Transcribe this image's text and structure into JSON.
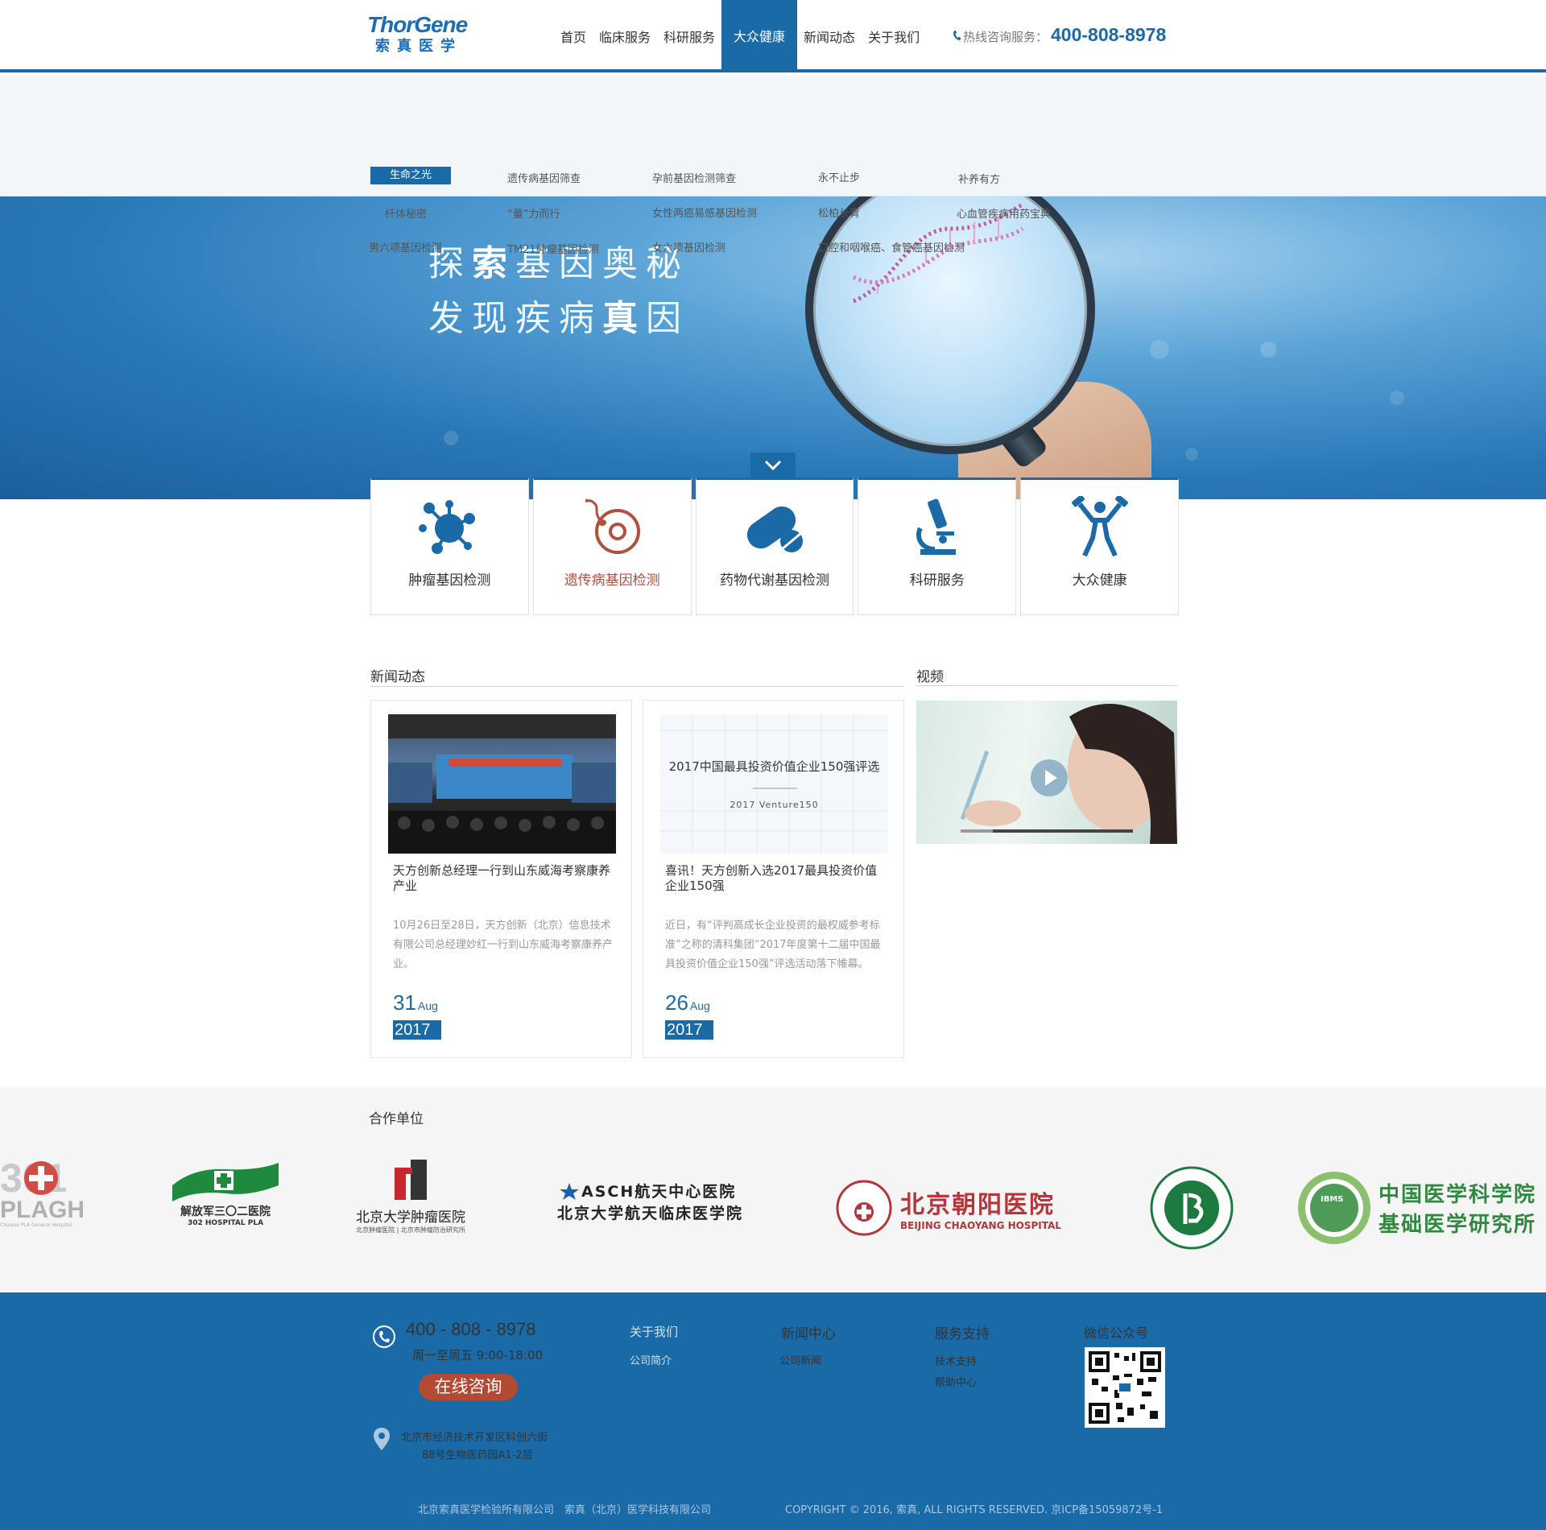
{
  "brand": {
    "name_en": "ThorGene",
    "name_cn": "索真医学"
  },
  "nav": {
    "items": [
      "首页",
      "临床服务",
      "科研服务",
      "大众健康",
      "新闻动态",
      "关于我们"
    ],
    "active_index": 3
  },
  "hotline": {
    "label": "热线咨询服务：",
    "number": "400-808-8978"
  },
  "dropdown": {
    "items": [
      "生命之光",
      "遗传病基因筛查",
      "孕前基因检测筛查",
      "永不止步",
      "补养有方",
      "纤体秘密",
      "“量”力而行",
      "女性两癌易感基因检测",
      "松柏长青",
      "心血管疾病用药宝典",
      "男六项基因检测",
      "TM21肿瘤基因检测",
      "女六项基因检测",
      "口腔和咽喉癌、食管癌基因检测"
    ]
  },
  "banner": {
    "line1_a": "探",
    "line1_b": "索",
    "line1_c": "基因奥秘",
    "line2_a": "发现疾病",
    "line2_b": "真",
    "line2_c": "因"
  },
  "services": [
    {
      "label": "肿瘤基因检测",
      "icon": "molecule-icon"
    },
    {
      "label": "遗传病基因检测",
      "icon": "sperm-egg-icon"
    },
    {
      "label": "药物代谢基因检测",
      "icon": "pill-icon"
    },
    {
      "label": "科研服务",
      "icon": "microscope-icon"
    },
    {
      "label": "大众健康",
      "icon": "fitness-person-icon"
    }
  ],
  "news": {
    "title": "新闻动态",
    "items": [
      {
        "title": "天方创新总经理一行到山东威海考察康养产业",
        "excerpt": "10月26日至28日，天方创新（北京）信息技术有限公司总经理妙红一行到山东威海考察康养产业。",
        "day": "31",
        "month": "Aug",
        "year": "2017"
      },
      {
        "title": "喜讯！天方创新入选2017最具投资价值企业150强",
        "excerpt": "近日，有“评判高成长企业投资的最权威参考标准”之称的清科集团“2017年度第十二届中国最具投资价值企业150强”评选活动落下帷幕。",
        "day": "26",
        "month": "Aug",
        "year": "2017",
        "image_caption": "2017中国最具投资价值企业150强评选",
        "image_sub": "2017 Venture150"
      }
    ]
  },
  "video": {
    "title": "视频"
  },
  "partners": {
    "title": "合作单位",
    "items": [
      {
        "name": "PLAGH",
        "sub": "Chinese PLA General Hospital",
        "mark": "301"
      },
      {
        "name": "解放军三〇二医院",
        "sub": "302 HOSPITAL PLA"
      },
      {
        "name": "北京大学肿瘤医院",
        "sub": "北京肿瘤医院 | 北京市肿瘤防治研究所"
      },
      {
        "name": "ASCH航天中心医院",
        "sub": "北京大学航天临床医学院"
      },
      {
        "name": "北京朝阳医院",
        "sub": "BEIJING CHAOYANG HOSPITAL"
      },
      {
        "name": "",
        "sub": ""
      },
      {
        "name": "中国医学科学院",
        "sub": "基础医学研究所",
        "mark": "IBMS"
      }
    ]
  },
  "footer": {
    "phone": "400 - 808 - 8978",
    "hours": "周一至周五 9:00-18:00",
    "consult": "在线咨询",
    "address_line1": "北京市经济技术开发区科创六街",
    "address_line2": "88号生物医药园A1-2层",
    "col_about": {
      "title": "关于我们",
      "links": [
        "公司简介"
      ]
    },
    "col_news": {
      "title": "新闻中心",
      "links": [
        "公司新闻"
      ]
    },
    "col_service": {
      "title": "服务支持",
      "links": [
        "技术支持",
        "帮助中心"
      ]
    },
    "wechat": "微信公众号",
    "company": "北京索真医学检验所有限公司　索真（北京）医学科技有限公司",
    "copyright": "COPYRIGHT © 2016, 索真, ALL RIGHTS RESERVED. 京ICP备15059872号-1"
  },
  "colors": {
    "primary": "#1a6aa8",
    "accent": "#b1503d"
  }
}
